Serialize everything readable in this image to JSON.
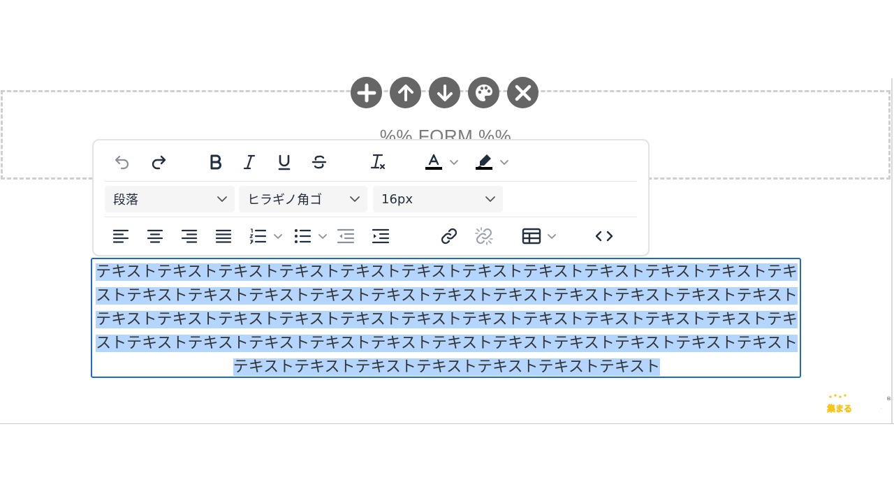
{
  "form_block": {
    "placeholder": "%% FORM %%"
  },
  "block_actions": [
    {
      "name": "add-block-button",
      "icon": "plus-icon"
    },
    {
      "name": "move-up-button",
      "icon": "arrow-up-icon"
    },
    {
      "name": "move-down-button",
      "icon": "arrow-down-icon"
    },
    {
      "name": "style-button",
      "icon": "palette-icon"
    },
    {
      "name": "delete-block-button",
      "icon": "close-icon"
    }
  ],
  "toolbar": {
    "block_format": "段落",
    "font_family": "ヒラギノ角ゴ",
    "font_size": "16px",
    "text_color": "#000000",
    "highlight_color": "#000000",
    "icons": [
      "undo-icon",
      "redo-icon",
      "bold-icon",
      "italic-icon",
      "underline-icon",
      "strikethrough-icon",
      "clear-format-icon",
      "text-color-icon",
      "highlight-icon",
      "align-left-icon",
      "align-center-icon",
      "align-right-icon",
      "align-justify-icon",
      "numbered-list-icon",
      "bullet-list-icon",
      "outdent-icon",
      "indent-icon",
      "link-icon",
      "unlink-icon",
      "table-icon",
      "source-code-icon"
    ]
  },
  "text_block": {
    "content": "テキストテキストテキストテキストテキストテキストテキストテキストテキストテキストテキストテキストテキストテキストテキストテキストテキストテキストテキストテキストテキストテキストテキストテキストテキストテキストテキストテキストテキストテキストテキストテキストテキストテキストテキストテキストテキストテキストテキストテキストテキストテキストテキストテキストテキストテキストテキストテキストテキストテキストテキストテキストテキスト"
  },
  "logo": {
    "text": "集まる集客"
  },
  "colors": {
    "selection": "#b4d5fe",
    "block_border": "#2068c5",
    "action_button": "#666666",
    "logo_pink": "#e8388a"
  }
}
